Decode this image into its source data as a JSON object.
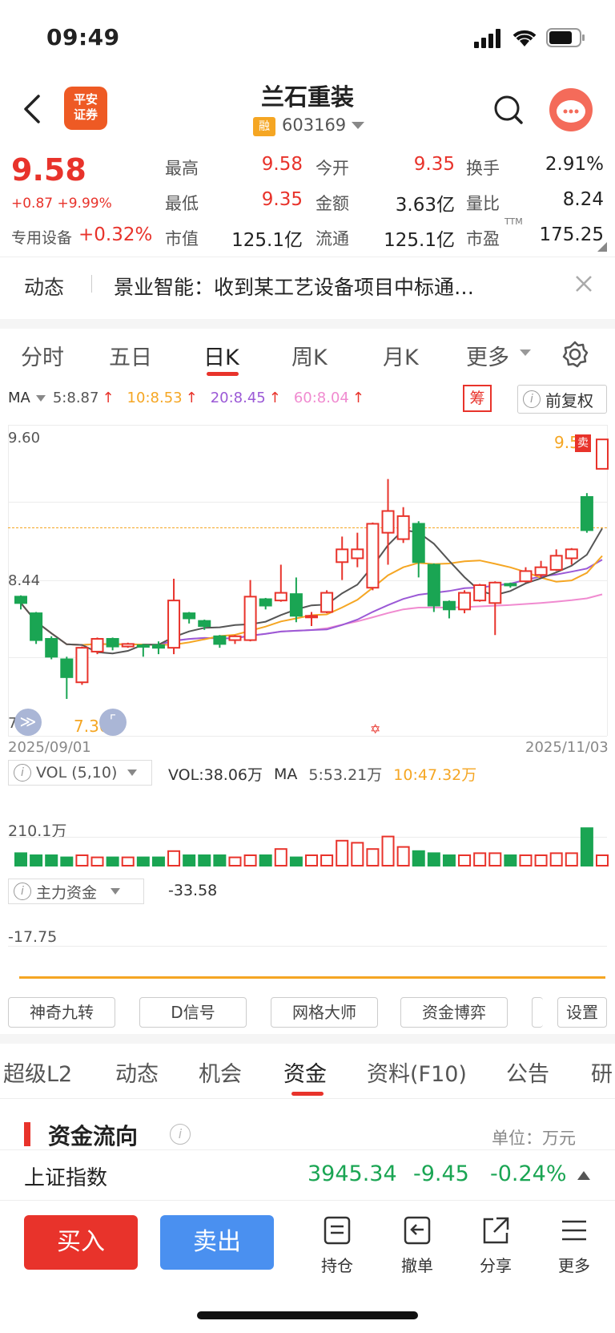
{
  "status": {
    "time": "09:49"
  },
  "header": {
    "logo_text_line1": "平安",
    "logo_text_line2": "证券",
    "stock_name": "兰石重装",
    "margin_badge": "融",
    "stock_code": "603169"
  },
  "quote": {
    "price": "9.58",
    "change": "+0.87 +9.99%",
    "sector": "专用设备",
    "sector_change": "+0.32%",
    "high_label": "最高",
    "high": "9.58",
    "low_label": "最低",
    "low": "9.35",
    "mcap_label": "市值",
    "mcap": "125.1亿",
    "open_label": "今开",
    "open": "9.35",
    "amount_label": "金额",
    "amount": "3.63亿",
    "float_label": "流通",
    "float": "125.1亿",
    "turnover_label": "换手",
    "turnover": "2.91%",
    "volratio_label": "量比",
    "volratio": "8.24",
    "pe_label": "市盈",
    "pe_sup": "TTM",
    "pe": "175.25"
  },
  "news": {
    "tag": "动态",
    "text": "景业智能：收到某工艺设备项目中标通…"
  },
  "ktabs": [
    "分时",
    "五日",
    "日K",
    "周K",
    "月K",
    "更多"
  ],
  "ma": {
    "label": "MA",
    "ma5": "5:8.87",
    "ma10": "10:8.53",
    "ma20": "20:8.45",
    "ma60": "60:8.04",
    "chip_btn": "筹",
    "adjust_btn": "前复权"
  },
  "chart_data": {
    "type": "candlestick",
    "y_top_label": "9.60",
    "y_mid_label": "8.44",
    "y_bottom_label": "7.28",
    "low_marker": "7.30",
    "high_marker": "9.58",
    "start_date": "2025/09/01",
    "end_date": "2025/11/03",
    "ylim": [
      7.28,
      9.6
    ],
    "candles": [
      {
        "o": 8.35,
        "c": 8.3,
        "h": 8.36,
        "l": 8.25
      },
      {
        "o": 8.22,
        "c": 8.01,
        "h": 8.23,
        "l": 7.98
      },
      {
        "o": 8.02,
        "c": 7.88,
        "h": 8.04,
        "l": 7.86
      },
      {
        "o": 7.86,
        "c": 7.72,
        "h": 7.88,
        "l": 7.55
      },
      {
        "o": 7.68,
        "c": 7.95,
        "h": 7.96,
        "l": 7.66
      },
      {
        "o": 7.92,
        "c": 8.02,
        "h": 8.03,
        "l": 7.9
      },
      {
        "o": 8.02,
        "c": 7.96,
        "h": 8.03,
        "l": 7.93
      },
      {
        "o": 7.96,
        "c": 7.98,
        "h": 7.99,
        "l": 7.95
      },
      {
        "o": 7.97,
        "c": 7.96,
        "h": 7.98,
        "l": 7.88
      },
      {
        "o": 7.97,
        "c": 7.95,
        "h": 8.0,
        "l": 7.9
      },
      {
        "o": 7.95,
        "c": 8.32,
        "h": 8.49,
        "l": 7.9
      },
      {
        "o": 8.22,
        "c": 8.18,
        "h": 8.23,
        "l": 8.14
      },
      {
        "o": 8.16,
        "c": 8.12,
        "h": 8.17,
        "l": 8.09
      },
      {
        "o": 8.04,
        "c": 7.98,
        "h": 8.05,
        "l": 7.95
      },
      {
        "o": 8.01,
        "c": 8.04,
        "h": 8.05,
        "l": 7.98
      },
      {
        "o": 8.01,
        "c": 8.35,
        "h": 8.48,
        "l": 8.0
      },
      {
        "o": 8.33,
        "c": 8.28,
        "h": 8.34,
        "l": 8.25
      },
      {
        "o": 8.32,
        "c": 8.38,
        "h": 8.6,
        "l": 8.31
      },
      {
        "o": 8.37,
        "c": 8.2,
        "h": 8.5,
        "l": 8.15
      },
      {
        "o": 8.2,
        "c": 8.2,
        "h": 8.23,
        "l": 8.12
      },
      {
        "o": 8.23,
        "c": 8.38,
        "h": 8.4,
        "l": 8.22
      },
      {
        "o": 8.62,
        "c": 8.72,
        "h": 8.82,
        "l": 8.48
      },
      {
        "o": 8.65,
        "c": 8.72,
        "h": 8.85,
        "l": 8.58
      },
      {
        "o": 8.42,
        "c": 8.92,
        "h": 8.93,
        "l": 8.4
      },
      {
        "o": 8.85,
        "c": 9.02,
        "h": 9.27,
        "l": 8.6
      },
      {
        "o": 8.8,
        "c": 8.98,
        "h": 9.05,
        "l": 8.77
      },
      {
        "o": 8.92,
        "c": 8.62,
        "h": 8.94,
        "l": 8.5
      },
      {
        "o": 8.6,
        "c": 8.28,
        "h": 8.61,
        "l": 8.23
      },
      {
        "o": 8.31,
        "c": 8.25,
        "h": 8.32,
        "l": 8.18
      },
      {
        "o": 8.25,
        "c": 8.38,
        "h": 8.4,
        "l": 8.22
      },
      {
        "o": 8.32,
        "c": 8.44,
        "h": 8.45,
        "l": 8.31
      },
      {
        "o": 8.3,
        "c": 8.46,
        "h": 8.47,
        "l": 8.05
      },
      {
        "o": 8.45,
        "c": 8.44,
        "h": 8.46,
        "l": 8.42
      },
      {
        "o": 8.47,
        "c": 8.55,
        "h": 8.58,
        "l": 8.46
      },
      {
        "o": 8.52,
        "c": 8.58,
        "h": 8.63,
        "l": 8.5
      },
      {
        "o": 8.56,
        "c": 8.67,
        "h": 8.72,
        "l": 8.55
      },
      {
        "o": 8.65,
        "c": 8.72,
        "h": 8.73,
        "l": 8.6
      },
      {
        "o": 9.13,
        "c": 8.87,
        "h": 9.16,
        "l": 8.85
      },
      {
        "o": 9.35,
        "c": 9.58,
        "h": 9.58,
        "l": 9.35
      }
    ]
  },
  "vol": {
    "label": "VOL (5,10)",
    "vol": "VOL:38.06万",
    "ma": "MA",
    "ma5": "5:53.21万",
    "ma10": "10:47.32万",
    "max_label": "210.1万"
  },
  "fund": {
    "label": "主力资金",
    "value": "-33.58",
    "max_label": "-17.75"
  },
  "fn_buttons": [
    "神奇九转",
    "D信号",
    "网格大师",
    "资金博弈",
    "设置"
  ],
  "section_tabs": [
    "超级L2",
    "动态",
    "机会",
    "资金",
    "资料(F10)",
    "公告",
    "研"
  ],
  "flow": {
    "title": "资金流向",
    "unit": "单位：万元"
  },
  "index_bar": {
    "name": "上证指数",
    "value": "3945.34",
    "change": "-9.45",
    "pct": "-0.24%"
  },
  "actions": {
    "buy": "买入",
    "sell": "卖出",
    "hold": "持仓",
    "cancel": "撤单",
    "share": "分享",
    "more": "更多"
  },
  "colors": {
    "up": "#e8332b",
    "down": "#1aa553",
    "ma5": "#555555",
    "ma10": "#f5a623",
    "ma20": "#9b59d6",
    "ma60": "#f08bd0",
    "sell_btn": "#4a90f0"
  }
}
